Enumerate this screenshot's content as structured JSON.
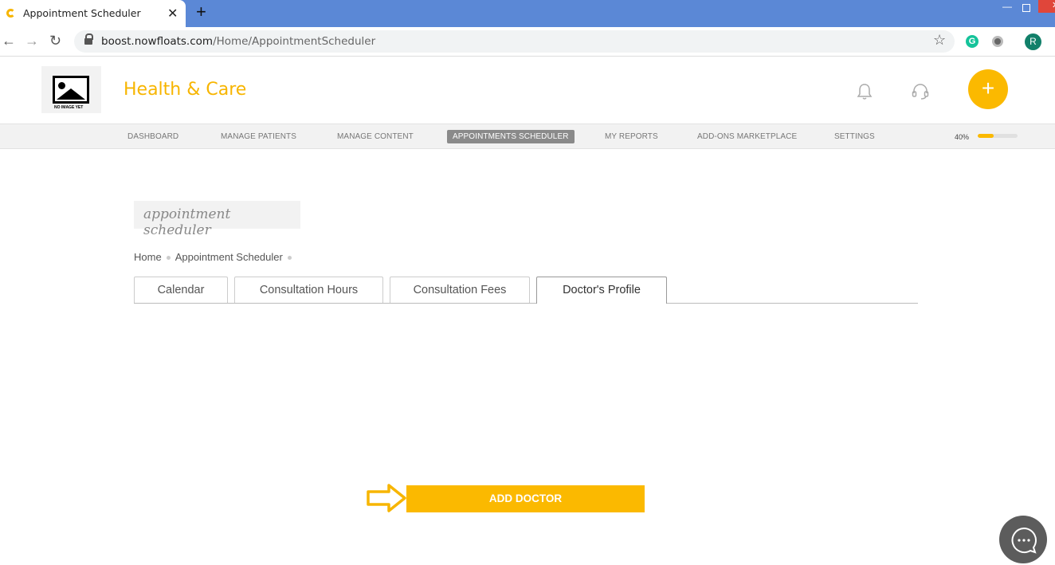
{
  "browser": {
    "tab_title": "Appointment Scheduler",
    "url_host": "boost.nowfloats.com",
    "url_path": "/Home/AppointmentScheduler",
    "profile_initial": "R",
    "extension_letter": "G"
  },
  "header": {
    "logo_caption": "NO IMAGE YET",
    "brand": "Health & Care",
    "fab_label": "+"
  },
  "nav": {
    "items": [
      {
        "label": "DASHBOARD"
      },
      {
        "label": "MANAGE PATIENTS"
      },
      {
        "label": "MANAGE CONTENT"
      },
      {
        "label": "APPOINTMENTS SCHEDULER"
      },
      {
        "label": "MY REPORTS"
      },
      {
        "label": "ADD-ONS MARKETPLACE"
      },
      {
        "label": "SETTINGS"
      }
    ],
    "active_index": 3,
    "progress_label": "40%",
    "progress_value": 0.4
  },
  "main": {
    "heading": "appointment scheduler",
    "breadcrumb": [
      "Home",
      "Appointment Scheduler"
    ],
    "tabs": [
      {
        "label": "Calendar"
      },
      {
        "label": "Consultation Hours"
      },
      {
        "label": "Consultation Fees"
      },
      {
        "label": "Doctor's Profile"
      }
    ],
    "active_tab": 3,
    "add_doctor_label": "ADD DOCTOR"
  },
  "colors": {
    "accent": "#fbb900",
    "brand_text": "#f7b500",
    "chrome_titlebar": "#5b88d6"
  }
}
